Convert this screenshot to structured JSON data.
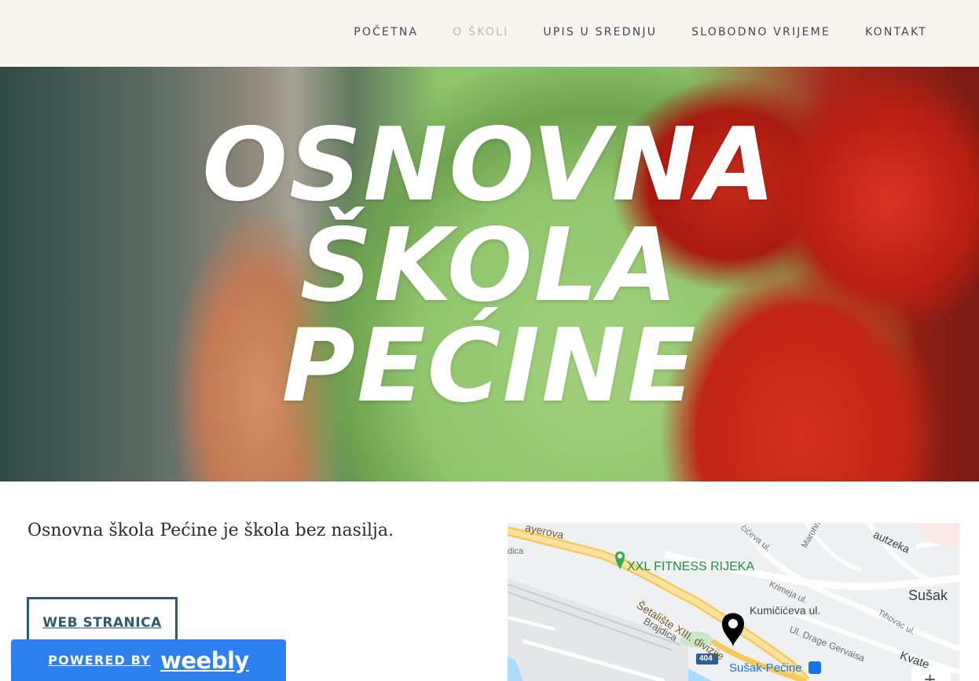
{
  "nav": {
    "items": [
      {
        "label": "POČETNA",
        "active": false
      },
      {
        "label": "O ŠKOLI",
        "active": true
      },
      {
        "label": "UPIS U SREDNJU",
        "active": false
      },
      {
        "label": "SLOBODNO VRIJEME",
        "active": false
      },
      {
        "label": "KONTAKT",
        "active": false
      }
    ]
  },
  "hero": {
    "title_line1": "OSNOVNA ŠKOLA",
    "title_line2": "PEĆINE"
  },
  "content": {
    "intro": "Osnovna škola Pećine je škola bez nasilja.",
    "web_button": "WEB STRANICA"
  },
  "map": {
    "labels": {
      "mayerova": "ayerova",
      "dica": "dica",
      "fitness": "XXL FITNESS RIJEKA",
      "setaliste": "Šetalište XIII. divizije",
      "brajdica": "Brajdica",
      "krimeja": "Krimeja ul.",
      "kumicic": "Kumičićeva ul.",
      "drage": "Ul. Drage Gervaisa",
      "susak": "Sušak",
      "susak_pecine": "Sušak-Pećine",
      "tihovac": "Tihovac ul.",
      "kvate": "Kvate",
      "road_404": "404",
      "kruzieva": "čićeva ul.",
      "marohnic": "Marohnić",
      "rautzeka": "autzeka"
    },
    "zoom_in": "+"
  },
  "badge": {
    "powered_by": "POWERED BY",
    "brand": "weebly"
  },
  "colors": {
    "nav_bg": "#f8f4ef",
    "nav_text": "#3d4a52",
    "nav_active": "#b9b6b1",
    "button_border": "#2e5a73",
    "badge_bg": "#2e80f0"
  }
}
